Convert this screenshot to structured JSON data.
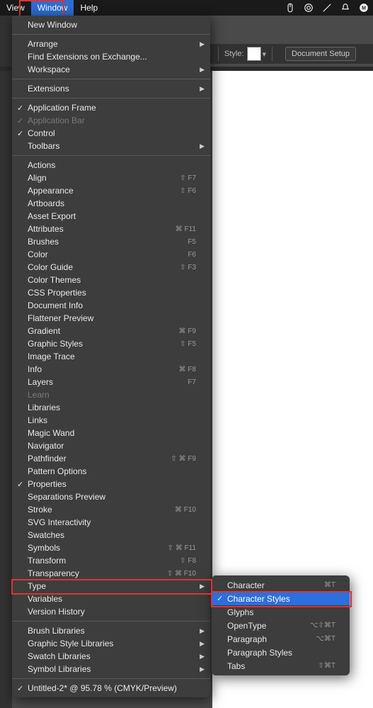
{
  "menubar": {
    "items": [
      "View",
      "Window",
      "Help"
    ],
    "active_index": 1,
    "status_icons": [
      "mouse-icon",
      "cc-icon",
      "pen-icon",
      "bell-icon",
      "m-icon"
    ]
  },
  "toolbar": {
    "style_label": "Style:",
    "doc_setup": "Document Setup"
  },
  "window_menu": {
    "groups": [
      [
        {
          "label": "New Window"
        }
      ],
      [
        {
          "label": "Arrange",
          "submenu": true
        },
        {
          "label": "Find Extensions on Exchange..."
        },
        {
          "label": "Workspace",
          "submenu": true
        }
      ],
      [
        {
          "label": "Extensions",
          "submenu": true
        }
      ],
      [
        {
          "label": "Application Frame",
          "checked": true
        },
        {
          "label": "Application Bar",
          "checked": true,
          "disabled": true
        },
        {
          "label": "Control",
          "checked": true
        },
        {
          "label": "Toolbars",
          "submenu": true
        }
      ],
      [
        {
          "label": "Actions"
        },
        {
          "label": "Align",
          "shortcut": "⇧ F7"
        },
        {
          "label": "Appearance",
          "shortcut": "⇧ F6"
        },
        {
          "label": "Artboards"
        },
        {
          "label": "Asset Export"
        },
        {
          "label": "Attributes",
          "shortcut": "⌘ F11"
        },
        {
          "label": "Brushes",
          "shortcut": "F5"
        },
        {
          "label": "Color",
          "shortcut": "F6"
        },
        {
          "label": "Color Guide",
          "shortcut": "⇧ F3"
        },
        {
          "label": "Color Themes"
        },
        {
          "label": "CSS Properties"
        },
        {
          "label": "Document Info"
        },
        {
          "label": "Flattener Preview"
        },
        {
          "label": "Gradient",
          "shortcut": "⌘ F9"
        },
        {
          "label": "Graphic Styles",
          "shortcut": "⇧ F5"
        },
        {
          "label": "Image Trace"
        },
        {
          "label": "Info",
          "shortcut": "⌘ F8"
        },
        {
          "label": "Layers",
          "shortcut": "F7"
        },
        {
          "label": "Learn",
          "disabled": true
        },
        {
          "label": "Libraries"
        },
        {
          "label": "Links"
        },
        {
          "label": "Magic Wand"
        },
        {
          "label": "Navigator"
        },
        {
          "label": "Pathfinder",
          "shortcut": "⇧ ⌘ F9"
        },
        {
          "label": "Pattern Options"
        },
        {
          "label": "Properties",
          "checked": true
        },
        {
          "label": "Separations Preview"
        },
        {
          "label": "Stroke",
          "shortcut": "⌘ F10"
        },
        {
          "label": "SVG Interactivity"
        },
        {
          "label": "Swatches"
        },
        {
          "label": "Symbols",
          "shortcut": "⇧ ⌘ F11"
        },
        {
          "label": "Transform",
          "shortcut": "⇧ F8"
        },
        {
          "label": "Transparency",
          "shortcut": "⇧ ⌘ F10"
        },
        {
          "label": "Type",
          "submenu": true,
          "highlight": true
        },
        {
          "label": "Variables"
        },
        {
          "label": "Version History"
        }
      ],
      [
        {
          "label": "Brush Libraries",
          "submenu": true
        },
        {
          "label": "Graphic Style Libraries",
          "submenu": true
        },
        {
          "label": "Swatch Libraries",
          "submenu": true
        },
        {
          "label": "Symbol Libraries",
          "submenu": true
        }
      ],
      [
        {
          "label": "Untitled-2* @ 95.78 % (CMYK/Preview)",
          "checked": true
        }
      ]
    ]
  },
  "type_submenu": {
    "items": [
      {
        "label": "Character",
        "shortcut": "⌘T"
      },
      {
        "label": "Character Styles",
        "checked": true,
        "selected": true
      },
      {
        "label": "Glyphs"
      },
      {
        "label": "OpenType",
        "shortcut": "⌥⇧⌘T"
      },
      {
        "label": "Paragraph",
        "shortcut": "⌥⌘T"
      },
      {
        "label": "Paragraph Styles"
      },
      {
        "label": "Tabs",
        "shortcut": "⇧⌘T"
      }
    ]
  }
}
